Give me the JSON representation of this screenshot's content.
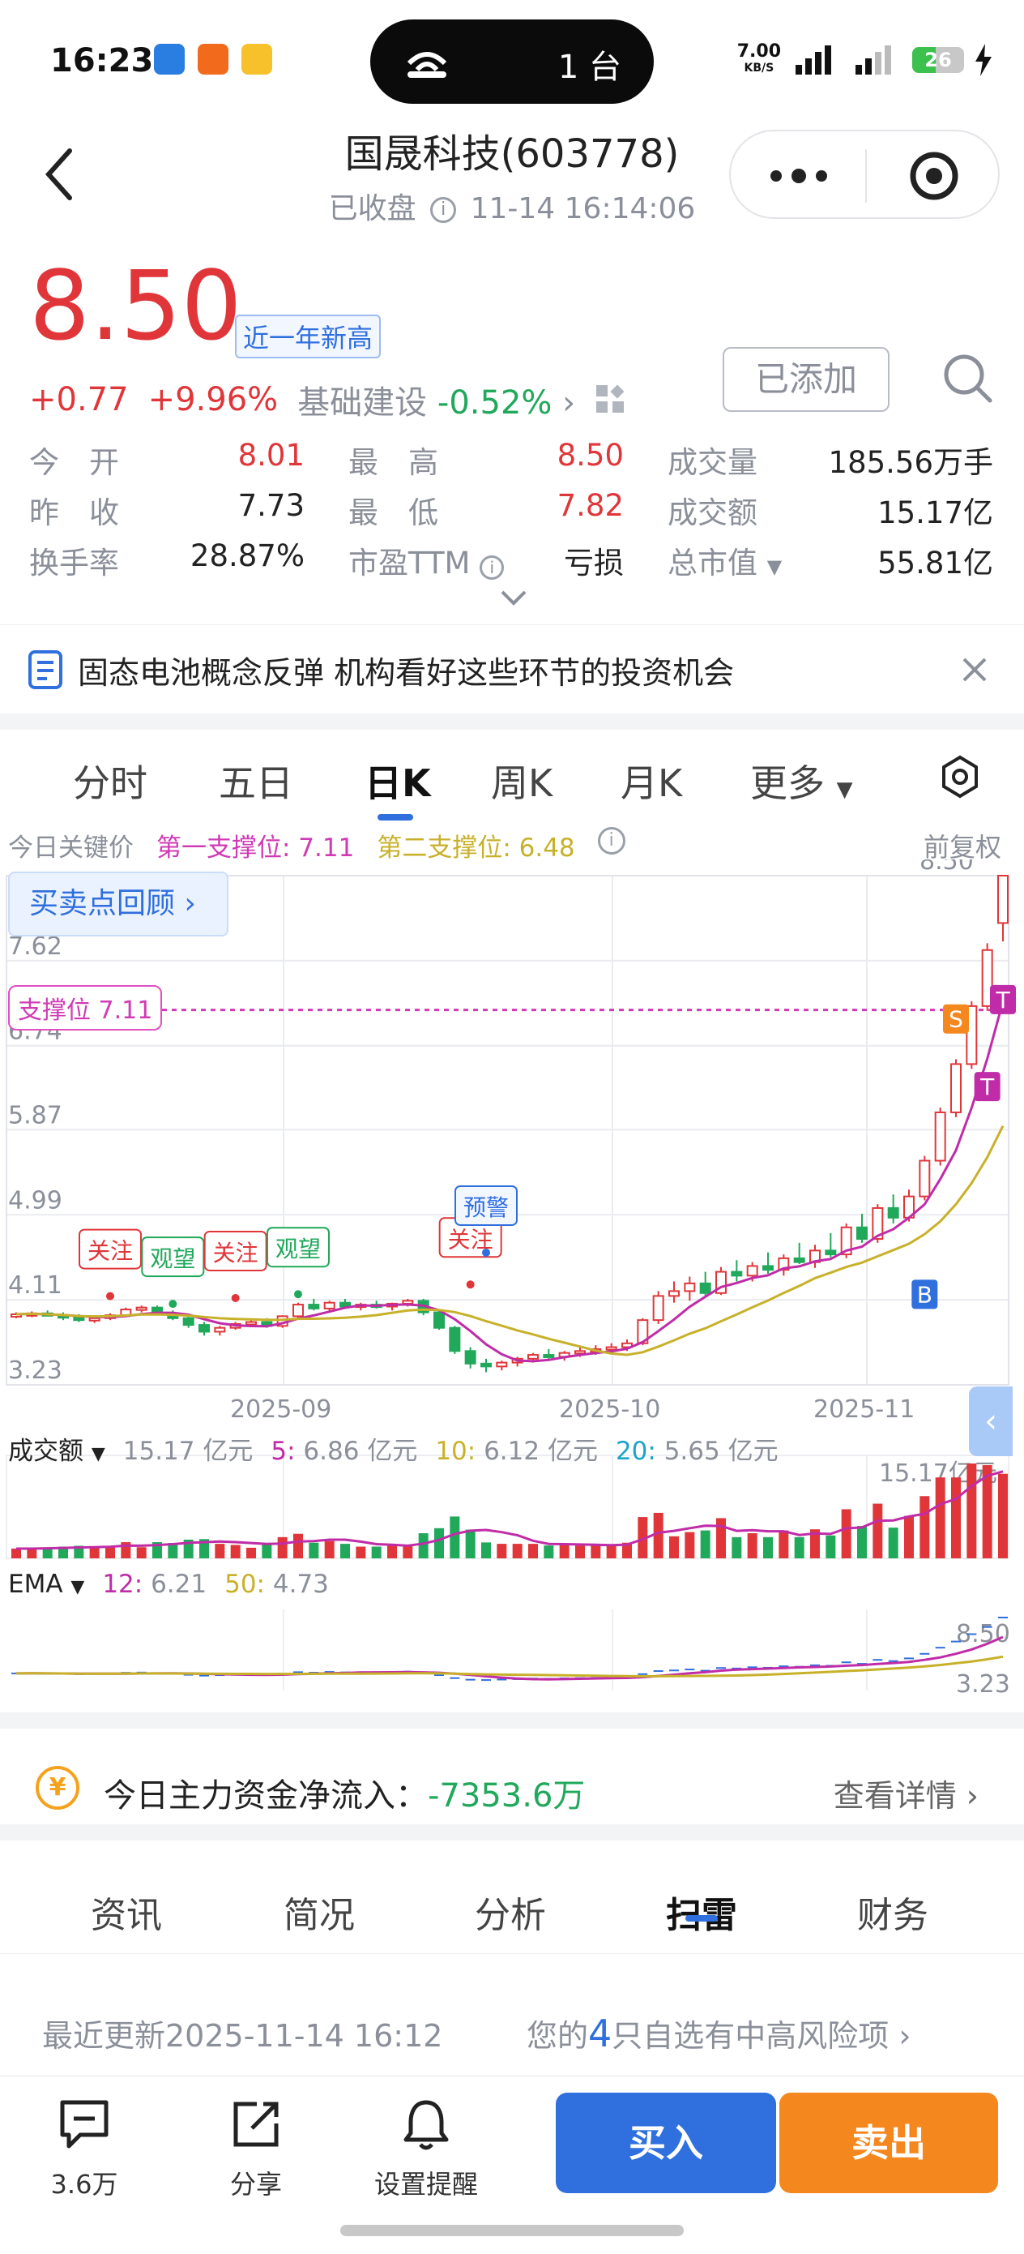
{
  "status_bar": {
    "time": "16:23",
    "island_count": "1 台",
    "net_speed_top": "7.00",
    "net_speed_unit": "KB/S",
    "battery": "26"
  },
  "nav": {
    "title": "国晟科技(603778)",
    "status": "已收盘",
    "timestamp": "11-14 16:14:06"
  },
  "quote": {
    "price": "8.50",
    "badge": "近一年新高",
    "change": "+0.77",
    "change_pct": "+9.96%",
    "sector": "基础建设",
    "sector_pct": "-0.52%",
    "added_label": "已添加",
    "fields": [
      {
        "label": "今　开",
        "value": "8.01",
        "color": "#e0363a"
      },
      {
        "label": "最　高",
        "value": "8.50",
        "color": "#e0363a"
      },
      {
        "label": "成交量",
        "value": "185.56万手",
        "color": "#222222"
      },
      {
        "label": "昨　收",
        "value": "7.73",
        "color": "#222222"
      },
      {
        "label": "最　低",
        "value": "7.82",
        "color": "#e0363a"
      },
      {
        "label": "成交额",
        "value": "15.17亿",
        "color": "#222222"
      },
      {
        "label": "换手率",
        "value": "28.87%",
        "color": "#222222"
      },
      {
        "label": "市盈TTM",
        "value": "亏损",
        "color": "#222222"
      },
      {
        "label": "总市值",
        "value": "55.81亿",
        "color": "#222222"
      }
    ]
  },
  "news": {
    "headline": "固态电池概念反弹 机构看好这些环节的投资机会"
  },
  "kline_tabs": [
    {
      "label": "分时"
    },
    {
      "label": "五日"
    },
    {
      "label": "日K"
    },
    {
      "label": "周K"
    },
    {
      "label": "月K"
    },
    {
      "label": "更多"
    }
  ],
  "key_prices": {
    "label": "今日关键价",
    "support1": "第一支撑位: 7.11",
    "support2": "第二支撑位: 6.48",
    "adjust": "前复权"
  },
  "chart_labels": {
    "review_button": "买卖点回顾",
    "support_tag": "支撑位 7.11",
    "signals": [
      "关注",
      "观望",
      "关注",
      "观望",
      "关注",
      "预警"
    ],
    "marker_s": "S",
    "marker_b": "B",
    "marker_t": "T"
  },
  "chart_data": {
    "type": "candlestick",
    "title": "",
    "x_ticks": [
      "2025-09",
      "2025-10",
      "2025-11"
    ],
    "y_ticks": [
      8.5,
      7.62,
      6.74,
      5.87,
      4.99,
      4.11,
      3.23
    ],
    "ylim": [
      3.23,
      8.5
    ],
    "support_line": 7.11,
    "grid": true,
    "ohlc": [
      [
        3.95,
        3.98,
        3.92,
        3.96
      ],
      [
        3.96,
        3.99,
        3.93,
        3.97
      ],
      [
        3.97,
        4.0,
        3.94,
        3.95
      ],
      [
        3.95,
        3.98,
        3.9,
        3.93
      ],
      [
        3.93,
        3.96,
        3.88,
        3.9
      ],
      [
        3.9,
        3.94,
        3.87,
        3.92
      ],
      [
        3.92,
        3.97,
        3.9,
        3.95
      ],
      [
        3.95,
        4.03,
        3.93,
        4.01
      ],
      [
        4.01,
        4.05,
        3.98,
        4.03
      ],
      [
        4.03,
        4.05,
        3.95,
        3.97
      ],
      [
        3.97,
        4.0,
        3.9,
        3.92
      ],
      [
        3.92,
        3.95,
        3.82,
        3.85
      ],
      [
        3.85,
        3.88,
        3.74,
        3.78
      ],
      [
        3.78,
        3.84,
        3.74,
        3.82
      ],
      [
        3.82,
        3.88,
        3.8,
        3.86
      ],
      [
        3.86,
        3.9,
        3.84,
        3.88
      ],
      [
        3.88,
        3.92,
        3.82,
        3.84
      ],
      [
        3.84,
        3.95,
        3.82,
        3.94
      ],
      [
        3.94,
        4.08,
        3.92,
        4.06
      ],
      [
        4.06,
        4.12,
        4.0,
        4.02
      ],
      [
        4.02,
        4.1,
        3.98,
        4.08
      ],
      [
        4.08,
        4.12,
        4.02,
        4.04
      ],
      [
        4.04,
        4.08,
        4.0,
        4.06
      ],
      [
        4.06,
        4.1,
        4.02,
        4.04
      ],
      [
        4.04,
        4.08,
        4.0,
        4.07
      ],
      [
        4.07,
        4.12,
        4.04,
        4.1
      ],
      [
        4.1,
        4.12,
        3.95,
        3.98
      ],
      [
        3.98,
        4.0,
        3.8,
        3.82
      ],
      [
        3.82,
        3.84,
        3.55,
        3.58
      ],
      [
        3.58,
        3.62,
        3.4,
        3.45
      ],
      [
        3.45,
        3.5,
        3.36,
        3.42
      ],
      [
        3.42,
        3.48,
        3.38,
        3.46
      ],
      [
        3.46,
        3.52,
        3.42,
        3.5
      ],
      [
        3.5,
        3.56,
        3.46,
        3.54
      ],
      [
        3.54,
        3.6,
        3.5,
        3.52
      ],
      [
        3.52,
        3.58,
        3.48,
        3.56
      ],
      [
        3.56,
        3.62,
        3.52,
        3.58
      ],
      [
        3.58,
        3.64,
        3.54,
        3.6
      ],
      [
        3.6,
        3.66,
        3.56,
        3.62
      ],
      [
        3.62,
        3.7,
        3.58,
        3.66
      ],
      [
        3.66,
        3.92,
        3.64,
        3.9
      ],
      [
        3.9,
        4.2,
        3.86,
        4.15
      ],
      [
        4.15,
        4.3,
        4.08,
        4.2
      ],
      [
        4.2,
        4.35,
        4.1,
        4.28
      ],
      [
        4.28,
        4.4,
        4.15,
        4.18
      ],
      [
        4.18,
        4.45,
        4.16,
        4.4
      ],
      [
        4.4,
        4.52,
        4.3,
        4.36
      ],
      [
        4.36,
        4.5,
        4.3,
        4.46
      ],
      [
        4.46,
        4.6,
        4.38,
        4.42
      ],
      [
        4.42,
        4.58,
        4.36,
        4.54
      ],
      [
        4.54,
        4.7,
        4.48,
        4.5
      ],
      [
        4.5,
        4.68,
        4.44,
        4.62
      ],
      [
        4.62,
        4.8,
        4.55,
        4.58
      ],
      [
        4.58,
        4.9,
        4.54,
        4.86
      ],
      [
        4.86,
        5.0,
        4.7,
        4.74
      ],
      [
        4.74,
        5.1,
        4.7,
        5.06
      ],
      [
        5.06,
        5.2,
        4.9,
        4.96
      ],
      [
        4.96,
        5.25,
        4.92,
        5.18
      ],
      [
        5.18,
        5.6,
        5.14,
        5.55
      ],
      [
        5.55,
        6.1,
        5.5,
        6.05
      ],
      [
        6.05,
        6.6,
        6.0,
        6.55
      ],
      [
        6.55,
        7.2,
        6.5,
        7.15
      ],
      [
        7.15,
        7.8,
        7.1,
        7.73
      ],
      [
        8.01,
        8.5,
        7.82,
        8.5
      ]
    ],
    "volume_panel": {
      "label": "成交额",
      "value": "15.17 亿元",
      "ma5": "6.86 亿元",
      "ma10": "6.12 亿元",
      "ma20": "5.65 亿元",
      "max_label": "15.17亿元"
    },
    "ema_panel": {
      "label": "EMA",
      "ema12": "6.21",
      "ema50": "4.73",
      "max_label": "8.50",
      "min_label": "3.23"
    }
  },
  "capital_flow": {
    "label": "今日主力资金净流入：",
    "value": "-7353.6万",
    "more": "查看详情"
  },
  "bottom_tabs": [
    {
      "label": "资讯"
    },
    {
      "label": "简况"
    },
    {
      "label": "分析"
    },
    {
      "label": "扫雷"
    },
    {
      "label": "财务"
    }
  ],
  "update_info": {
    "left": "最近更新2025-11-14 16:12",
    "right_prefix": "您的",
    "right_count": "4",
    "right_suffix": "只自选有中高风险项"
  },
  "actions": {
    "comments": "3.6万",
    "share": "分享",
    "alert": "设置提醒",
    "buy": "买入",
    "sell": "卖出"
  },
  "colors": {
    "up": "#e0363a",
    "down": "#20a85b",
    "accent": "#2f6fde",
    "sell": "#f5871f",
    "ma_magenta": "#c02ca8",
    "ma_gold": "#c8b12a"
  }
}
